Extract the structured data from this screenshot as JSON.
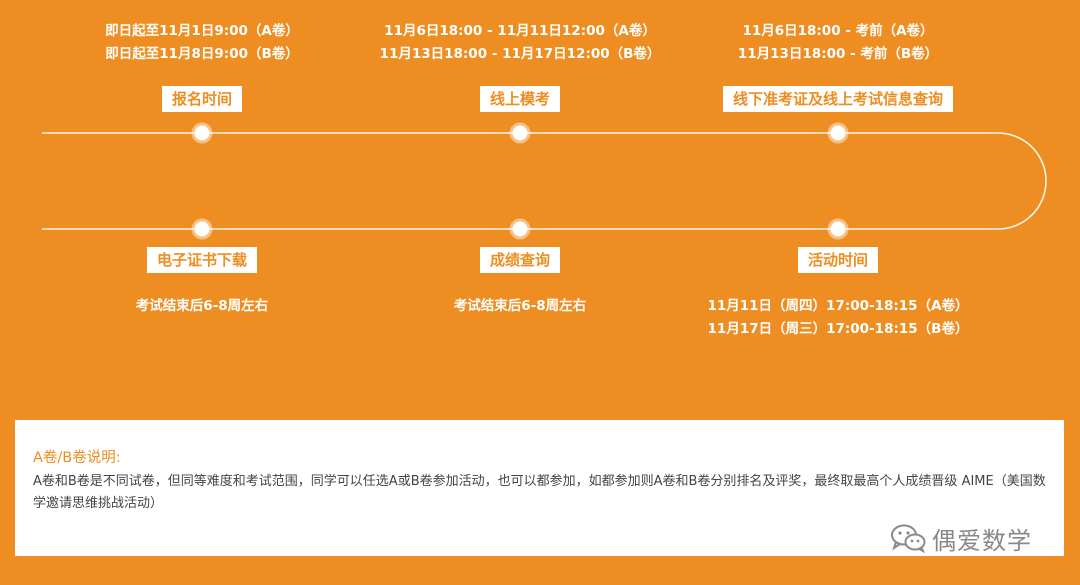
{
  "timeline": {
    "top": [
      {
        "label": "报名时间",
        "lines": [
          "即日起至11月1日9:00（A卷）",
          "即日起至11月8日9:00（B卷）"
        ]
      },
      {
        "label": "线上模考",
        "lines": [
          "11月6日18:00 - 11月11日12:00（A卷）",
          "11月13日18:00 - 11月17日12:00（B卷）"
        ]
      },
      {
        "label": "线下准考证及线上考试信息查询",
        "lines": [
          "11月6日18:00 - 考前（A卷）",
          "11月13日18:00 - 考前（B卷）"
        ]
      }
    ],
    "bottom": [
      {
        "label": "电子证书下载",
        "lines": [
          "考试结束后6-8周左右"
        ]
      },
      {
        "label": "成绩查询",
        "lines": [
          "考试结束后6-8周左右"
        ]
      },
      {
        "label": "活动时间",
        "lines": [
          "11月11日（周四）17:00-18:15（A卷）",
          "11月17日（周三）17:00-18:15（B卷）"
        ]
      }
    ]
  },
  "note": {
    "title": "A卷/B卷说明:",
    "body": "A卷和B卷是不同试卷，但同等难度和考试范围，同学可以任选A或B卷参加活动，也可以都参加，如都参加则A卷和B卷分别排名及评奖，最终取最高个人成绩晋级 AIME（美国数学邀请思维挑战活动）"
  },
  "watermark": {
    "text": "偶爱数学",
    "icon": "wechat-icon"
  },
  "colors": {
    "background": "#ee8e22",
    "accent": "#ee8e22",
    "panel": "#ffffff"
  }
}
